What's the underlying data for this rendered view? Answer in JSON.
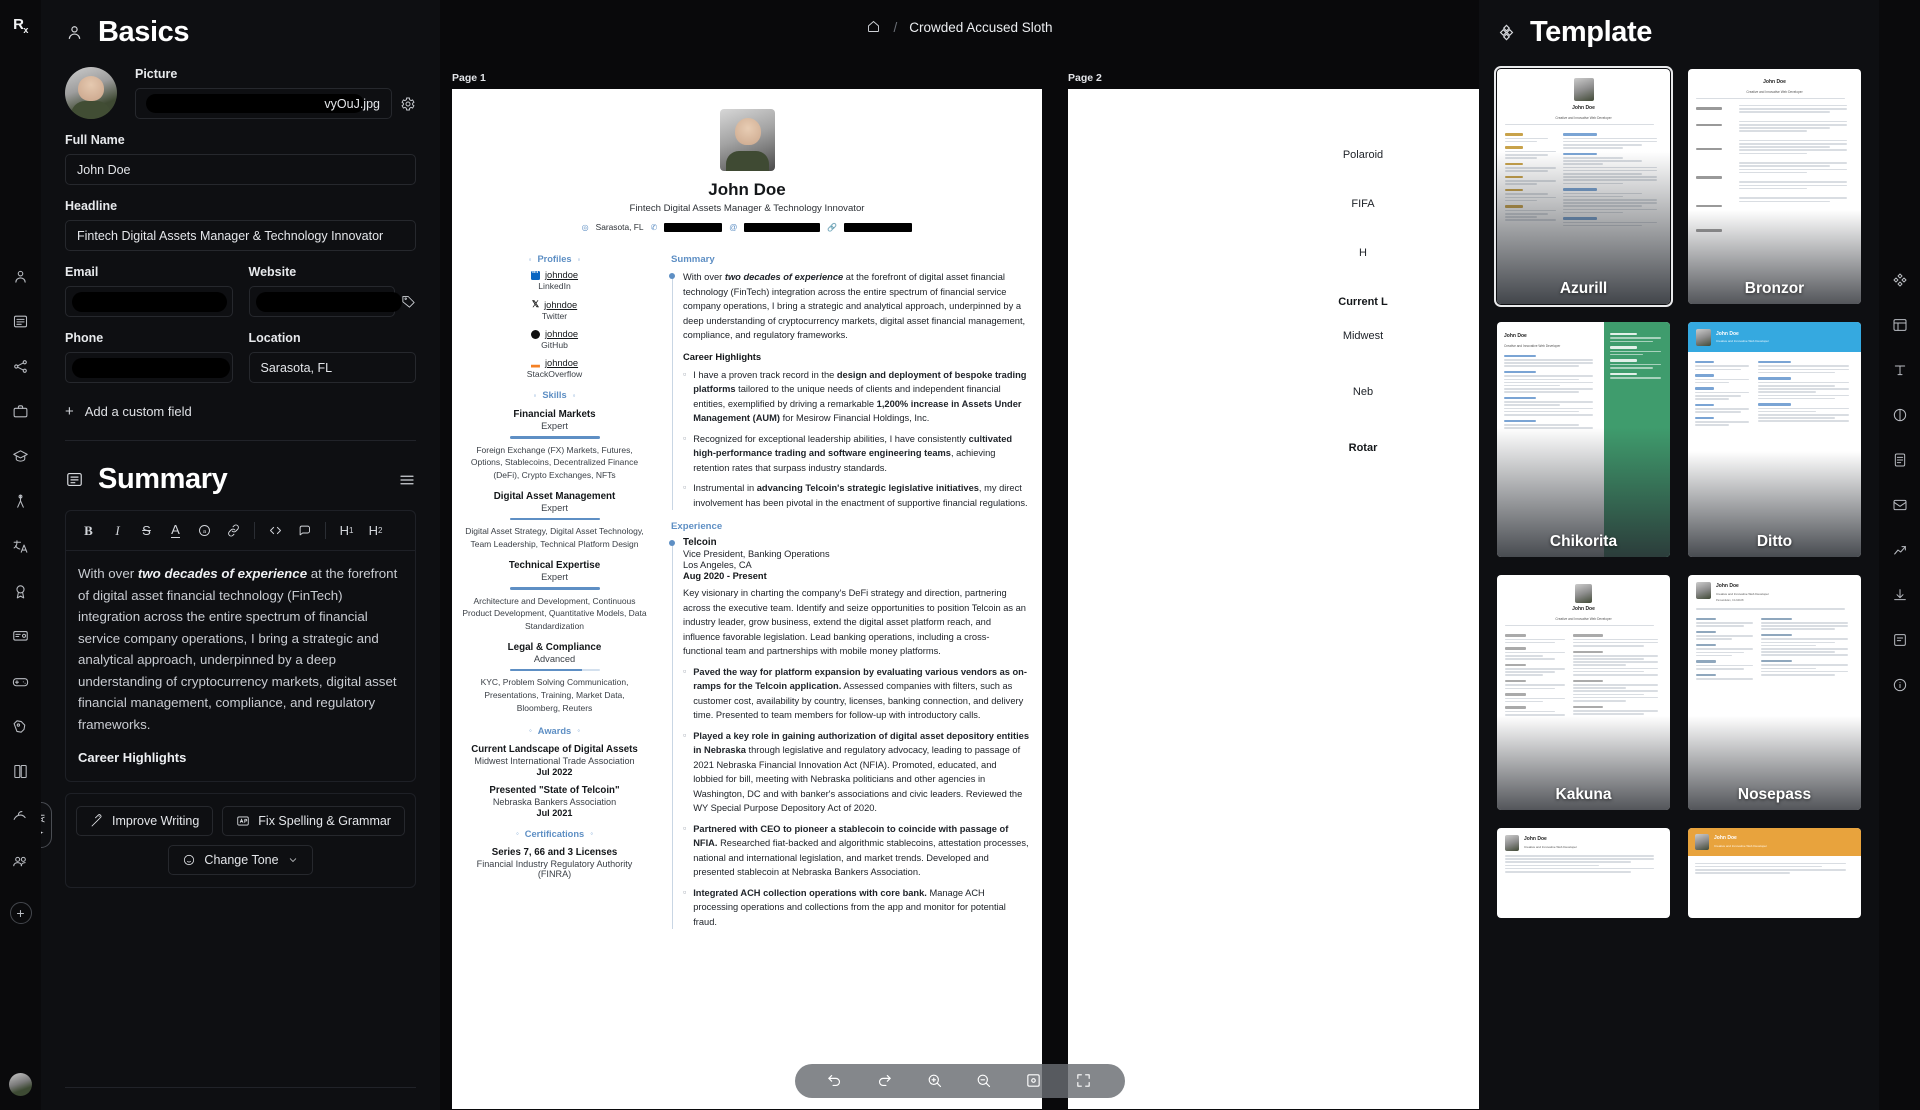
{
  "app": {
    "logo": "Rx"
  },
  "left_rail": {
    "icons": [
      "basics-icon",
      "summary-icon",
      "profiles-icon",
      "experience-icon",
      "education-icon",
      "skills-icon",
      "languages-icon",
      "awards-icon",
      "certifications-icon",
      "interests-icon",
      "projects-icon",
      "publications-icon",
      "volunteering-icon",
      "references-icon",
      "add-section-icon"
    ]
  },
  "basics": {
    "title": "Basics",
    "picture_label": "Picture",
    "picture_value": "vyOuJ.jpg",
    "fullname_label": "Full Name",
    "fullname_value": "John Doe",
    "headline_label": "Headline",
    "headline_value": "Fintech Digital Assets Manager & Technology Innovator",
    "email_label": "Email",
    "email_value": "",
    "website_label": "Website",
    "website_value": "",
    "phone_label": "Phone",
    "phone_value": "",
    "location_label": "Location",
    "location_value": "Sarasota, FL",
    "add_custom_field": "Add a custom field"
  },
  "summary": {
    "title": "Summary",
    "toolbar": [
      "B",
      "I",
      "S",
      "A",
      "@",
      "link",
      "code",
      "quote",
      "H1",
      "H2"
    ],
    "paragraph_lead": "With over ",
    "paragraph_bold": "two decades of experience",
    "paragraph_rest": " at the forefront of digital asset financial technology (FinTech) integration across the entire spectrum of financial service company operations, I bring a strategic and analytical approach, underpinned by a deep understanding of cryptocurrency markets, digital asset financial management, compliance, and regulatory frameworks.",
    "career_highlights": "Career Highlights",
    "ai_buttons": [
      "Improve Writing",
      "Fix Spelling & Grammar",
      "Change Tone"
    ],
    "ai_tab": "AI"
  },
  "topbar": {
    "home_icon": "home-icon",
    "separator": "/",
    "title": "Crowded Accused Sloth"
  },
  "preview": {
    "page1_label": "Page 1",
    "page2_label": "Page 2",
    "undo": "undo-icon",
    "redo": "redo-icon"
  },
  "resume": {
    "name": "John Doe",
    "headline": "Fintech Digital Assets Manager & Technology Innovator",
    "location": "Sarasota, FL",
    "profiles_label": "Profiles",
    "profiles": [
      {
        "user": "johndoe",
        "network": "LinkedIn",
        "icon": "linkedin-icon"
      },
      {
        "user": "johndoe",
        "network": "Twitter",
        "icon": "twitter-x-icon"
      },
      {
        "user": "johndoe",
        "network": "GitHub",
        "icon": "github-icon"
      },
      {
        "user": "johndoe",
        "network": "StackOverflow",
        "icon": "stackoverflow-icon"
      }
    ],
    "skills_label": "Skills",
    "skills": [
      {
        "name": "Financial Markets",
        "level": "Expert",
        "pct": 100,
        "keywords": "Foreign Exchange (FX) Markets, Futures, Options, Stablecoins, Decentralized Finance (DeFi), Crypto Exchanges, NFTs"
      },
      {
        "name": "Digital Asset Management",
        "level": "Expert",
        "pct": 100,
        "keywords": "Digital Asset Strategy, Digital Asset Technology, Team Leadership, Technical Platform Design"
      },
      {
        "name": "Technical Expertise",
        "level": "Expert",
        "pct": 100,
        "keywords": "Architecture and Development, Continuous Product Development, Quantitative Models, Data Standardization"
      },
      {
        "name": "Legal & Compliance",
        "level": "Advanced",
        "pct": 80,
        "keywords": "KYC, Problem Solving Communication, Presentations, Training, Market Data, Bloomberg, Reuters"
      }
    ],
    "awards_label": "Awards",
    "awards": [
      {
        "title": "Current Landscape of Digital Assets",
        "issuer": "Midwest International Trade Association",
        "date": "Jul 2022"
      },
      {
        "title": "Presented \"State of Telcoin\"",
        "issuer": "Nebraska Bankers Association",
        "date": "Jul 2021"
      }
    ],
    "certifications_label": "Certifications",
    "certifications": [
      {
        "title": "Series 7, 66 and 3 Licenses",
        "issuer": "Financial Industry Regulatory Authority (FINRA)"
      }
    ],
    "summary_label": "Summary",
    "summary_lead": "With over ",
    "summary_bold": "two decades of experience",
    "summary_rest": " at the forefront of digital asset financial technology (FinTech) integration across the entire spectrum of financial service company operations, I bring a strategic and analytical approach, underpinned by a deep understanding of cryptocurrency markets, digital asset financial management, compliance, and regulatory frameworks.",
    "career_highlights_label": "Career Highlights",
    "highlights": [
      {
        "pre": "I have a proven track record in the ",
        "b1": "design and deployment of bespoke trading platforms",
        "mid": " tailored to the unique needs of clients and independent financial entities, exemplified by driving a remarkable ",
        "b2": "1,200% increase in Assets Under Management (AUM)",
        "post": " for Mesirow Financial Holdings, Inc."
      },
      {
        "pre": "Recognized for exceptional leadership abilities, I have consistently ",
        "b1": "cultivated high-performance trading and software engineering teams",
        "mid": ", achieving retention rates that surpass industry standards.",
        "b2": "",
        "post": ""
      },
      {
        "pre": "Instrumental in ",
        "b1": "advancing Telcoin's strategic legislative initiatives",
        "mid": ", my direct involvement has been pivotal in the enactment of supportive financial regulations.",
        "b2": "",
        "post": ""
      }
    ],
    "experience_label": "Experience",
    "experience": {
      "company": "Telcoin",
      "role": "Vice President, Banking Operations",
      "location": "Los Angeles, CA",
      "dates": "Aug 2020 - Present",
      "summary": "Key visionary in charting the company's DeFi strategy and direction, partnering across the executive team. Identify and seize opportunities to position Telcoin as an industry leader, grow business, extend the digital asset platform reach, and influence favorable legislation. Lead banking operations, including a cross-functional team and partnerships with mobile money platforms.",
      "bullets": [
        {
          "b": "Paved the way for platform expansion by evaluating various vendors as on-ramps for the Telcoin application.",
          "t": " Assessed companies with filters, such as customer cost, availability by country, licenses, banking connection, and delivery time. Presented to team members for follow-up with introductory calls."
        },
        {
          "b": "Played a key role in gaining authorization of digital asset depository entities in Nebraska",
          "t": " through legislative and regulatory advocacy, leading to passage of 2021 Nebraska Financial Innovation Act (NFIA). Promoted, educated, and lobbied for bill, meeting with Nebraska politicians and other agencies in Washington, DC and with banker's associations and civic leaders. Reviewed the WY Special Purpose Depository Act of 2020."
        },
        {
          "b": "Partnered with CEO to pioneer a stablecoin to coincide with passage of NFIA.",
          "t": " Researched fiat-backed and algorithmic stablecoins, attestation processes, national and international legislation, and market trends. Developed and presented stablecoin at Nebraska Bankers Association."
        },
        {
          "b": "Integrated ACH collection operations with core bank.",
          "t": " Manage ACH processing operations and collections from the app and monitor for potential fraud."
        }
      ]
    },
    "page2_fragments": [
      "Polaroid",
      "FIFA",
      "H",
      "Current L",
      "Midwest",
      "Neb",
      "Rotar"
    ]
  },
  "templates": {
    "title": "Template",
    "icon": "template-icon",
    "items": [
      {
        "name": "Azurill",
        "selected": true,
        "accent": "#c8a24a",
        "style": "dark"
      },
      {
        "name": "Bronzor",
        "selected": false,
        "accent": "#7a7a7a",
        "style": "plain"
      },
      {
        "name": "Chikorita",
        "selected": false,
        "accent": "#3f9c6d",
        "style": "green"
      },
      {
        "name": "Ditto",
        "selected": false,
        "accent": "#35a9e0",
        "style": "blue"
      },
      {
        "name": "Kakuna",
        "selected": false,
        "accent": "#6f6f6f",
        "style": "plain"
      },
      {
        "name": "Nosepass",
        "selected": false,
        "accent": "#6f6f6f",
        "style": "plain"
      },
      {
        "name": "",
        "selected": false,
        "accent": "#6f6f6f",
        "style": "plain"
      },
      {
        "name": "",
        "selected": false,
        "accent": "#e8a33d",
        "style": "orange"
      }
    ]
  },
  "right_rail": {
    "icons": [
      "template-icon",
      "layout-icon",
      "typography-icon",
      "theme-icon",
      "page-icon",
      "sharing-icon",
      "statistics-icon",
      "export-icon",
      "notes-icon",
      "information-icon"
    ]
  }
}
